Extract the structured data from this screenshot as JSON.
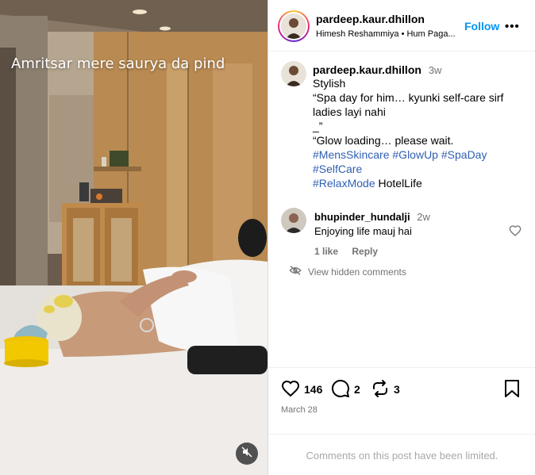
{
  "media": {
    "overlay_caption": "Amritsar mere saurya da pind",
    "mute_icon": "speaker-muted-icon"
  },
  "post": {
    "author": "pardeep.kaur.dhillon",
    "audio": "Himesh Reshammiya • Hum Paga...",
    "follow_label": "Follow",
    "more_label": "•••",
    "caption": {
      "author": "pardeep.kaur.dhillon",
      "time": "3w",
      "lines": [
        "Stylish",
        "“Spa day for him… kyunki self-care sirf",
        "ladies layi nahi",
        "_”",
        "“Glow loading… please wait."
      ],
      "hashtags_line1": [
        "#MensSkincare",
        "#GlowUp",
        "#SpaDay"
      ],
      "hashtags_line2": [
        "#SelfCare"
      ],
      "hashtag_line3": "#RelaxMode",
      "plain_tag": "HotelLife"
    },
    "comment": {
      "author": "bhupinder_hundalji",
      "time": "2w",
      "text": "Enjoying life mauj hai",
      "likes": "1 like",
      "reply_label": "Reply"
    },
    "hidden_comments_label": "View hidden comments",
    "likes_count": "146",
    "comments_count": "2",
    "shares_count": "3",
    "date": "March 28",
    "limited_notice": "Comments on this post have been limited."
  },
  "colors": {
    "link_blue": "#0095f6",
    "hashtag_blue": "#2f5fb3",
    "muted_gray": "#737373",
    "notice_gray": "#a8a8a8"
  }
}
